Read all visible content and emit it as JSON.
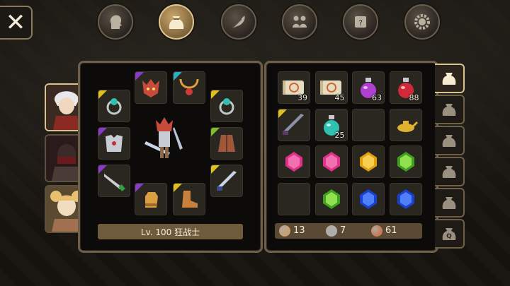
{
  "level_label": "Lv. 100 狂战士",
  "coins": [
    {
      "name": "gold",
      "value": "13",
      "color": "#c8a070"
    },
    {
      "name": "silver",
      "value": "7",
      "color": "#b0b0b0"
    },
    {
      "name": "copper",
      "value": "61",
      "color": "#c87a5a"
    }
  ],
  "top_tabs": [
    {
      "icon": "head-icon",
      "active": false
    },
    {
      "icon": "bag-icon",
      "active": true
    },
    {
      "icon": "skill-feather-icon",
      "active": false
    },
    {
      "icon": "party-icon",
      "active": false
    },
    {
      "icon": "quest-scroll-icon",
      "active": false
    },
    {
      "icon": "gear-icon",
      "active": false
    }
  ],
  "inventory": [
    {
      "icon": "scroll-icon",
      "qty": "39"
    },
    {
      "icon": "scroll-icon",
      "qty": "45"
    },
    {
      "icon": "purple-potion-icon",
      "qty": "63"
    },
    {
      "icon": "red-potion-icon",
      "qty": "88"
    },
    {
      "icon": "greatsword-icon",
      "qty": ""
    },
    {
      "icon": "teal-potion-icon",
      "qty": "25"
    },
    {
      "icon": "",
      "qty": ""
    },
    {
      "icon": "magic-lamp-icon",
      "qty": ""
    },
    {
      "icon": "pink-gem-icon",
      "qty": ""
    },
    {
      "icon": "pink-gem-icon",
      "qty": ""
    },
    {
      "icon": "yellow-gem-icon",
      "qty": ""
    },
    {
      "icon": "green-gem-icon",
      "qty": ""
    },
    {
      "icon": "",
      "qty": ""
    },
    {
      "icon": "green-gem-icon",
      "qty": ""
    },
    {
      "icon": "blue-gem-icon",
      "qty": ""
    },
    {
      "icon": "blue-gem-icon",
      "qty": ""
    }
  ],
  "side_tabs_label_q": "Q"
}
